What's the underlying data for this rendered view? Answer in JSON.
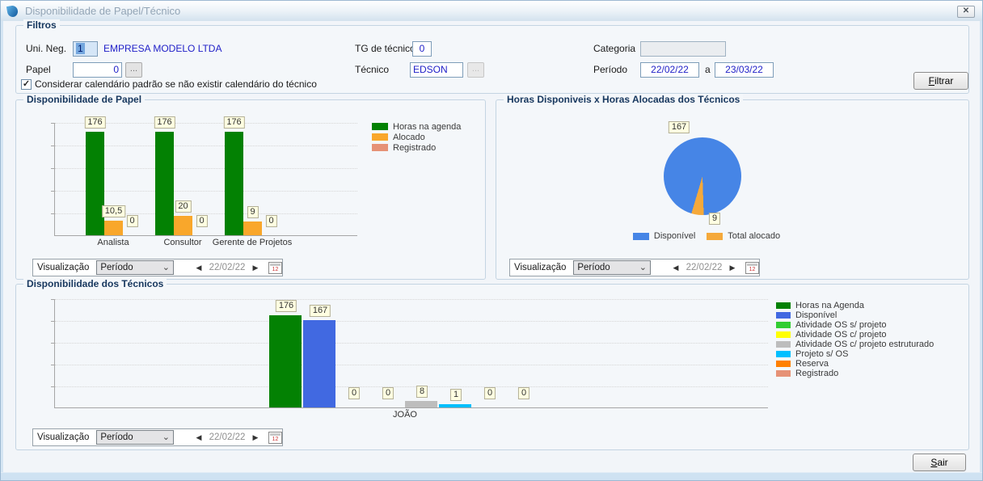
{
  "window": {
    "title": "Disponibilidade de Papel/Técnico"
  },
  "icons": {
    "close": "✕",
    "browse": "...",
    "check": "✓",
    "prev": "◀",
    "next": "▶",
    "chevron": "⌄"
  },
  "filters": {
    "group_title": "Filtros",
    "uni_neg_label": "Uni. Neg.",
    "uni_neg_value": "1",
    "uni_neg_name": "EMPRESA MODELO LTDA",
    "papel_label": "Papel",
    "papel_value": "0",
    "tg_label": "TG de técnicos",
    "tg_value": "0",
    "tecnico_label": "Técnico",
    "tecnico_value": "EDSON",
    "categoria_label": "Categoria",
    "categoria_value": "",
    "periodo_label": "Período",
    "periodo_from": "22/02/22",
    "periodo_sep": "a",
    "periodo_to": "23/03/22",
    "calendar_checkbox_label": "Considerar calendário padrão se não existir calendário do técnico",
    "calendar_checkbox_checked": true,
    "filtrar_label": "Filtrar"
  },
  "visualizacao": {
    "label": "Visualização",
    "mode": "Período",
    "date": "22/02/22"
  },
  "footer": {
    "sair_label": "Sair"
  },
  "chart_data": [
    {
      "id": "papel",
      "type": "bar",
      "title": "Disponibilidade de Papel",
      "categories": [
        "Analista",
        "Consultor",
        "Gerente de Projetos"
      ],
      "series": [
        {
          "name": "Horas na agenda",
          "color": "#038103",
          "values": [
            176,
            176,
            176
          ]
        },
        {
          "name": "Alocado",
          "color": "#F9A72B",
          "values": [
            10.5,
            20,
            9
          ]
        },
        {
          "name": "Registrado",
          "color": "#E69276",
          "values": [
            0,
            0,
            0
          ]
        }
      ],
      "value_labels": [
        [
          "176",
          "176",
          "176"
        ],
        [
          "10,5",
          "20",
          "9"
        ],
        [
          "0",
          "0",
          "0"
        ]
      ],
      "ylim": [
        0,
        190
      ],
      "grid": true,
      "legend_position": "right"
    },
    {
      "id": "horas-tecnicos",
      "type": "pie",
      "title": "Horas Disponiveis x Horas Alocadas dos Técnicos",
      "slices": [
        {
          "label": "Disponível",
          "value": 167,
          "color": "#4685E6"
        },
        {
          "label": "Total alocado",
          "value": 9,
          "color": "#F5A93B"
        }
      ],
      "legend_position": "bottom"
    },
    {
      "id": "tecnicos",
      "type": "bar",
      "title": "Disponibilidade dos Técnicos",
      "categories": [
        "JOÃO"
      ],
      "series": [
        {
          "name": "Horas na Agenda",
          "color": "#038103",
          "values": [
            176
          ]
        },
        {
          "name": "Disponível",
          "color": "#4169E1",
          "values": [
            167
          ]
        },
        {
          "name": "Atividade OS s/ projeto",
          "color": "#32CD32",
          "values": [
            0
          ]
        },
        {
          "name": "Atividade OS c/ projeto",
          "color": "#FFFF00",
          "values": [
            0
          ]
        },
        {
          "name": "Atividade OS c/ projeto estruturado",
          "color": "#BDBDBD",
          "values": [
            8
          ]
        },
        {
          "name": "Projeto s/ OS",
          "color": "#00BFFF",
          "values": [
            1
          ]
        },
        {
          "name": "Reserva",
          "color": "#FF8000",
          "values": [
            0
          ]
        },
        {
          "name": "Registrado",
          "color": "#E69276",
          "values": [
            0
          ]
        }
      ],
      "value_labels": [
        [
          "176"
        ],
        [
          "167"
        ],
        [
          "0"
        ],
        [
          "0"
        ],
        [
          "8"
        ],
        [
          "1"
        ],
        [
          "0"
        ],
        [
          "0"
        ]
      ],
      "ylim": [
        0,
        190
      ],
      "grid": true,
      "legend_position": "right"
    }
  ]
}
